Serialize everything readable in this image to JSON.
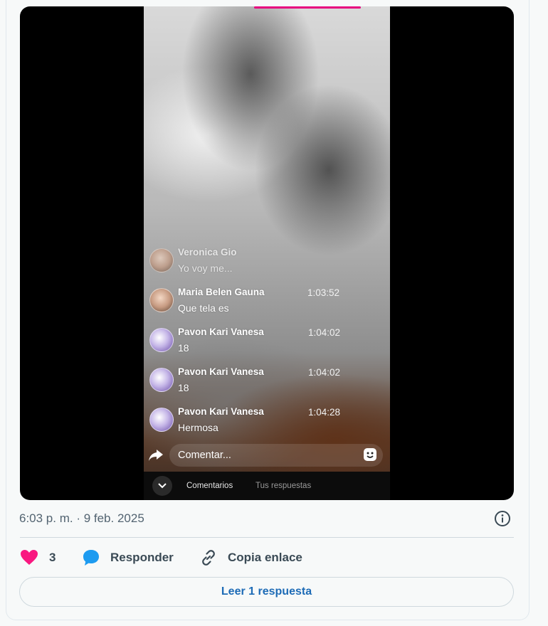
{
  "video": {
    "comments": [
      {
        "name": "Veronica Gio",
        "time": "",
        "text": "Yo voy me...",
        "faded": true
      },
      {
        "name": "Maria Belen Gauna",
        "time": "1:03:52",
        "text": "Que tela es"
      },
      {
        "name": "Pavon Kari Vanesa",
        "time": "1:04:02",
        "text": "18"
      },
      {
        "name": "Pavon Kari Vanesa",
        "time": "1:04:02",
        "text": "18"
      },
      {
        "name": "Pavon Kari Vanesa",
        "time": "1:04:28",
        "text": "Hermosa"
      }
    ],
    "comment_placeholder": "Comentar...",
    "tabs": [
      "Comentarios",
      "Tus respuestas"
    ]
  },
  "post": {
    "timestamp": "6:03 p. m. · 9 feb. 2025",
    "like_count": "3",
    "reply_label": "Responder",
    "copy_link_label": "Copia enlace",
    "read_replies_label": "Leer 1 respuesta"
  },
  "colors": {
    "like": "#f91880",
    "reply": "#1d9bf0",
    "link_text": "#1d6bb6"
  }
}
